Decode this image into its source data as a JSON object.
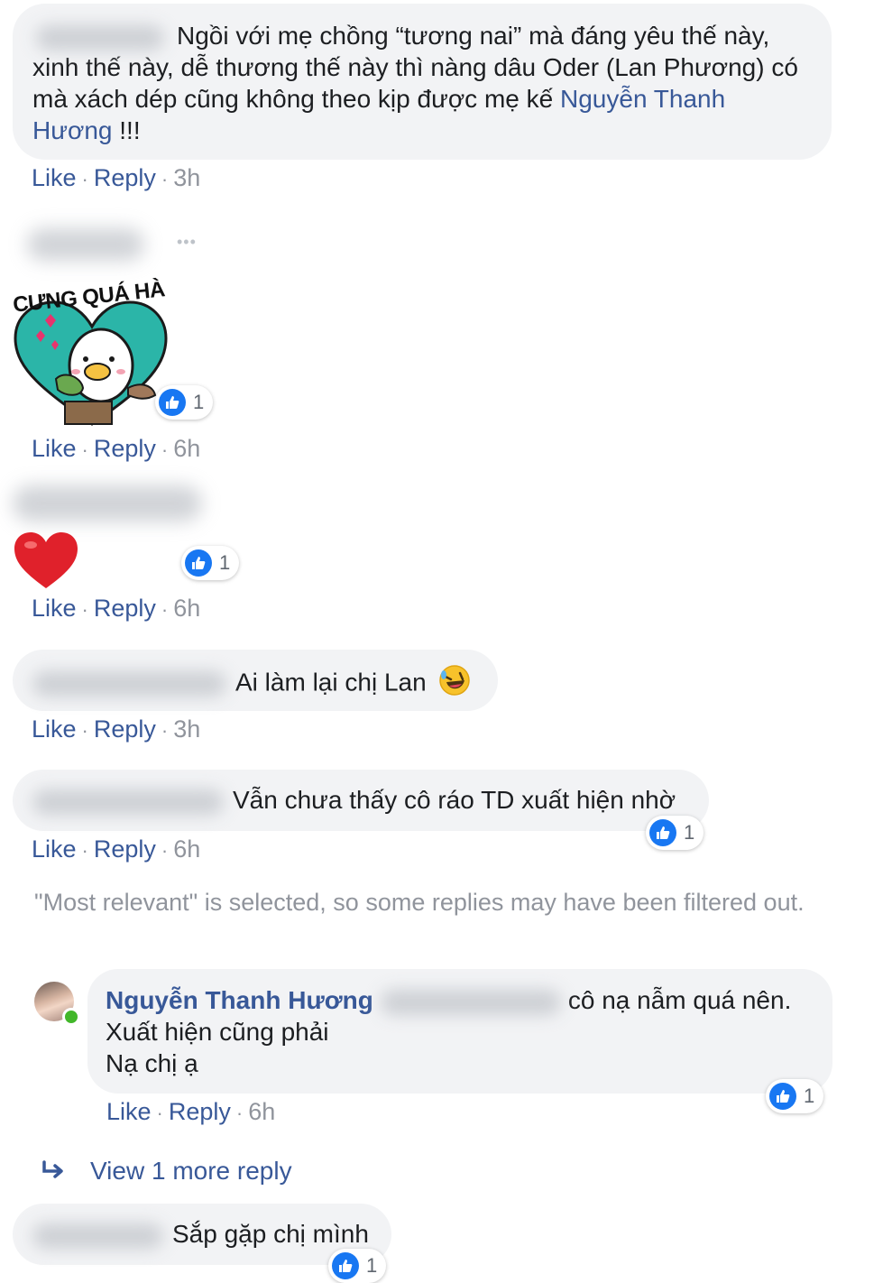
{
  "comments": [
    {
      "text_part1": "Ngồi với mẹ chồng “tương nai” mà đáng yêu thế này, xinh thế này, dễ thương thế này thì nàng dâu Oder (Lan Phương) có mà xách dép cũng không theo kịp được mẹ kế ",
      "mention": "Nguyễn Thanh Hương",
      "text_part2": " !!!",
      "like": "Like",
      "reply": "Reply",
      "time": "3h"
    },
    {
      "options": "•••",
      "sticker_text": "CƯNG QUÁ HÀ",
      "reaction_count": "1",
      "like": "Like",
      "reply": "Reply",
      "time": "6h"
    },
    {
      "emoji": "heart",
      "reaction_count": "1",
      "like": "Like",
      "reply": "Reply",
      "time": "6h"
    },
    {
      "text": "Ai làm lại chị Lan",
      "emoji": "rolling-laughing",
      "like": "Like",
      "reply": "Reply",
      "time": "3h"
    },
    {
      "text": "Vẫn chưa thấy cô ráo TD xuất hiện nhờ",
      "reaction_count": "1",
      "like": "Like",
      "reply": "Reply",
      "time": "6h"
    }
  ],
  "filter_notice": "\"Most relevant\" is selected, so some replies may have been filtered out.",
  "reply": {
    "author": "Nguyễn Thanh Hương",
    "text_inline": "cô nạ nẫm quá nên.",
    "line2": "Xuất hiện cũng phải",
    "line3": "Nạ chị ạ",
    "reaction_count": "1",
    "like": "Like",
    "reply": "Reply",
    "time": "6h"
  },
  "view_more": "View 1 more reply",
  "last_comment": {
    "text": "Sắp gặp chị mình",
    "reaction_count": "1"
  },
  "colors": {
    "link": "#385898",
    "bubble": "#f2f3f5",
    "like_blue": "#1877f2",
    "muted": "#90949c"
  }
}
